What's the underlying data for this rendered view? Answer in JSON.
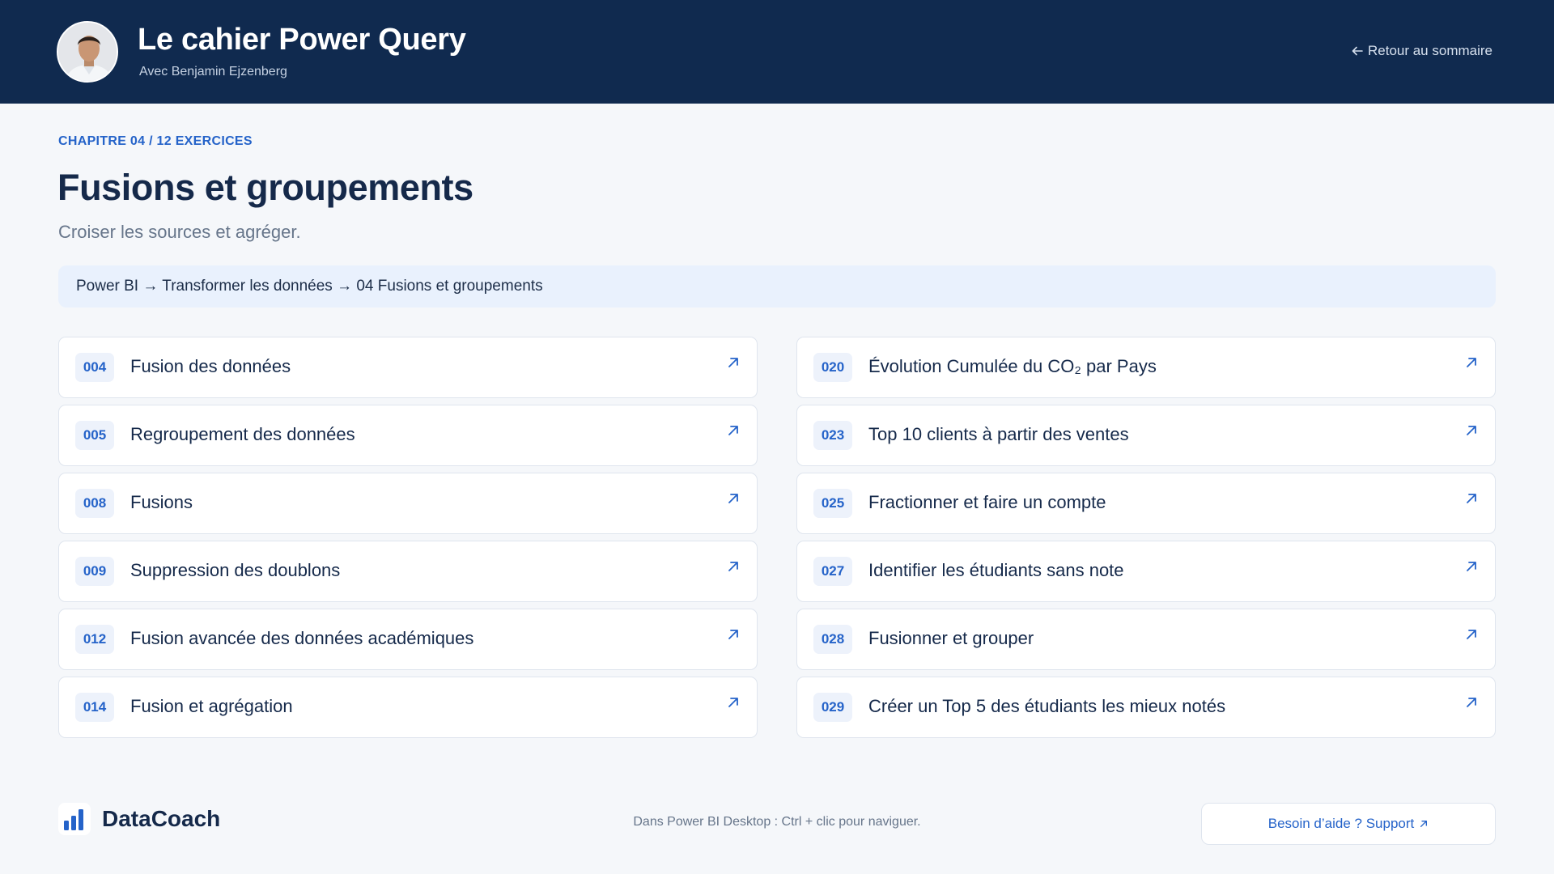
{
  "header": {
    "title": "Le cahier Power Query",
    "subtitle": "Avec Benjamin Ejzenberg",
    "back_label": "Retour au sommaire"
  },
  "chapter": {
    "kicker": "CHAPITRE 04 / 12 EXERCICES",
    "title": "Fusions et groupements",
    "subtitle": "Croiser les sources et agréger.",
    "path": "Power BI → Transformer les données → 04 Fusions et groupements"
  },
  "exercises_left": [
    {
      "num": "004",
      "label": "Fusion des données"
    },
    {
      "num": "005",
      "label": "Regroupement des données"
    },
    {
      "num": "008",
      "label": "Fusions"
    },
    {
      "num": "009",
      "label": "Suppression des doublons"
    },
    {
      "num": "012",
      "label": "Fusion avancée des données académiques"
    },
    {
      "num": "014",
      "label": "Fusion et agrégation"
    }
  ],
  "exercises_right": [
    {
      "num": "020",
      "label": "Évolution Cumulée du CO₂ par Pays"
    },
    {
      "num": "023",
      "label": "Top 10 clients à partir des ventes"
    },
    {
      "num": "025",
      "label": "Fractionner et faire un compte"
    },
    {
      "num": "027",
      "label": "Identifier les étudiants sans note"
    },
    {
      "num": "028",
      "label": "Fusionner et grouper"
    },
    {
      "num": "029",
      "label": "Créer un Top 5 des étudiants les mieux notés"
    }
  ],
  "footer": {
    "brand": "DataCoach",
    "hint": "Dans Power BI Desktop : Ctrl + clic pour naviguer.",
    "support_label": "Besoin d’aide ? Support"
  },
  "icons": {
    "back": "arrow-left-icon",
    "card_link": "arrow-up-right-icon",
    "brand": "bar-chart-icon",
    "support": "arrow-up-right-icon"
  },
  "colors": {
    "header_bg": "#102a4f",
    "accent": "#2563c9",
    "page_bg": "#f5f7fa",
    "path_bg": "#e9f1fd"
  }
}
